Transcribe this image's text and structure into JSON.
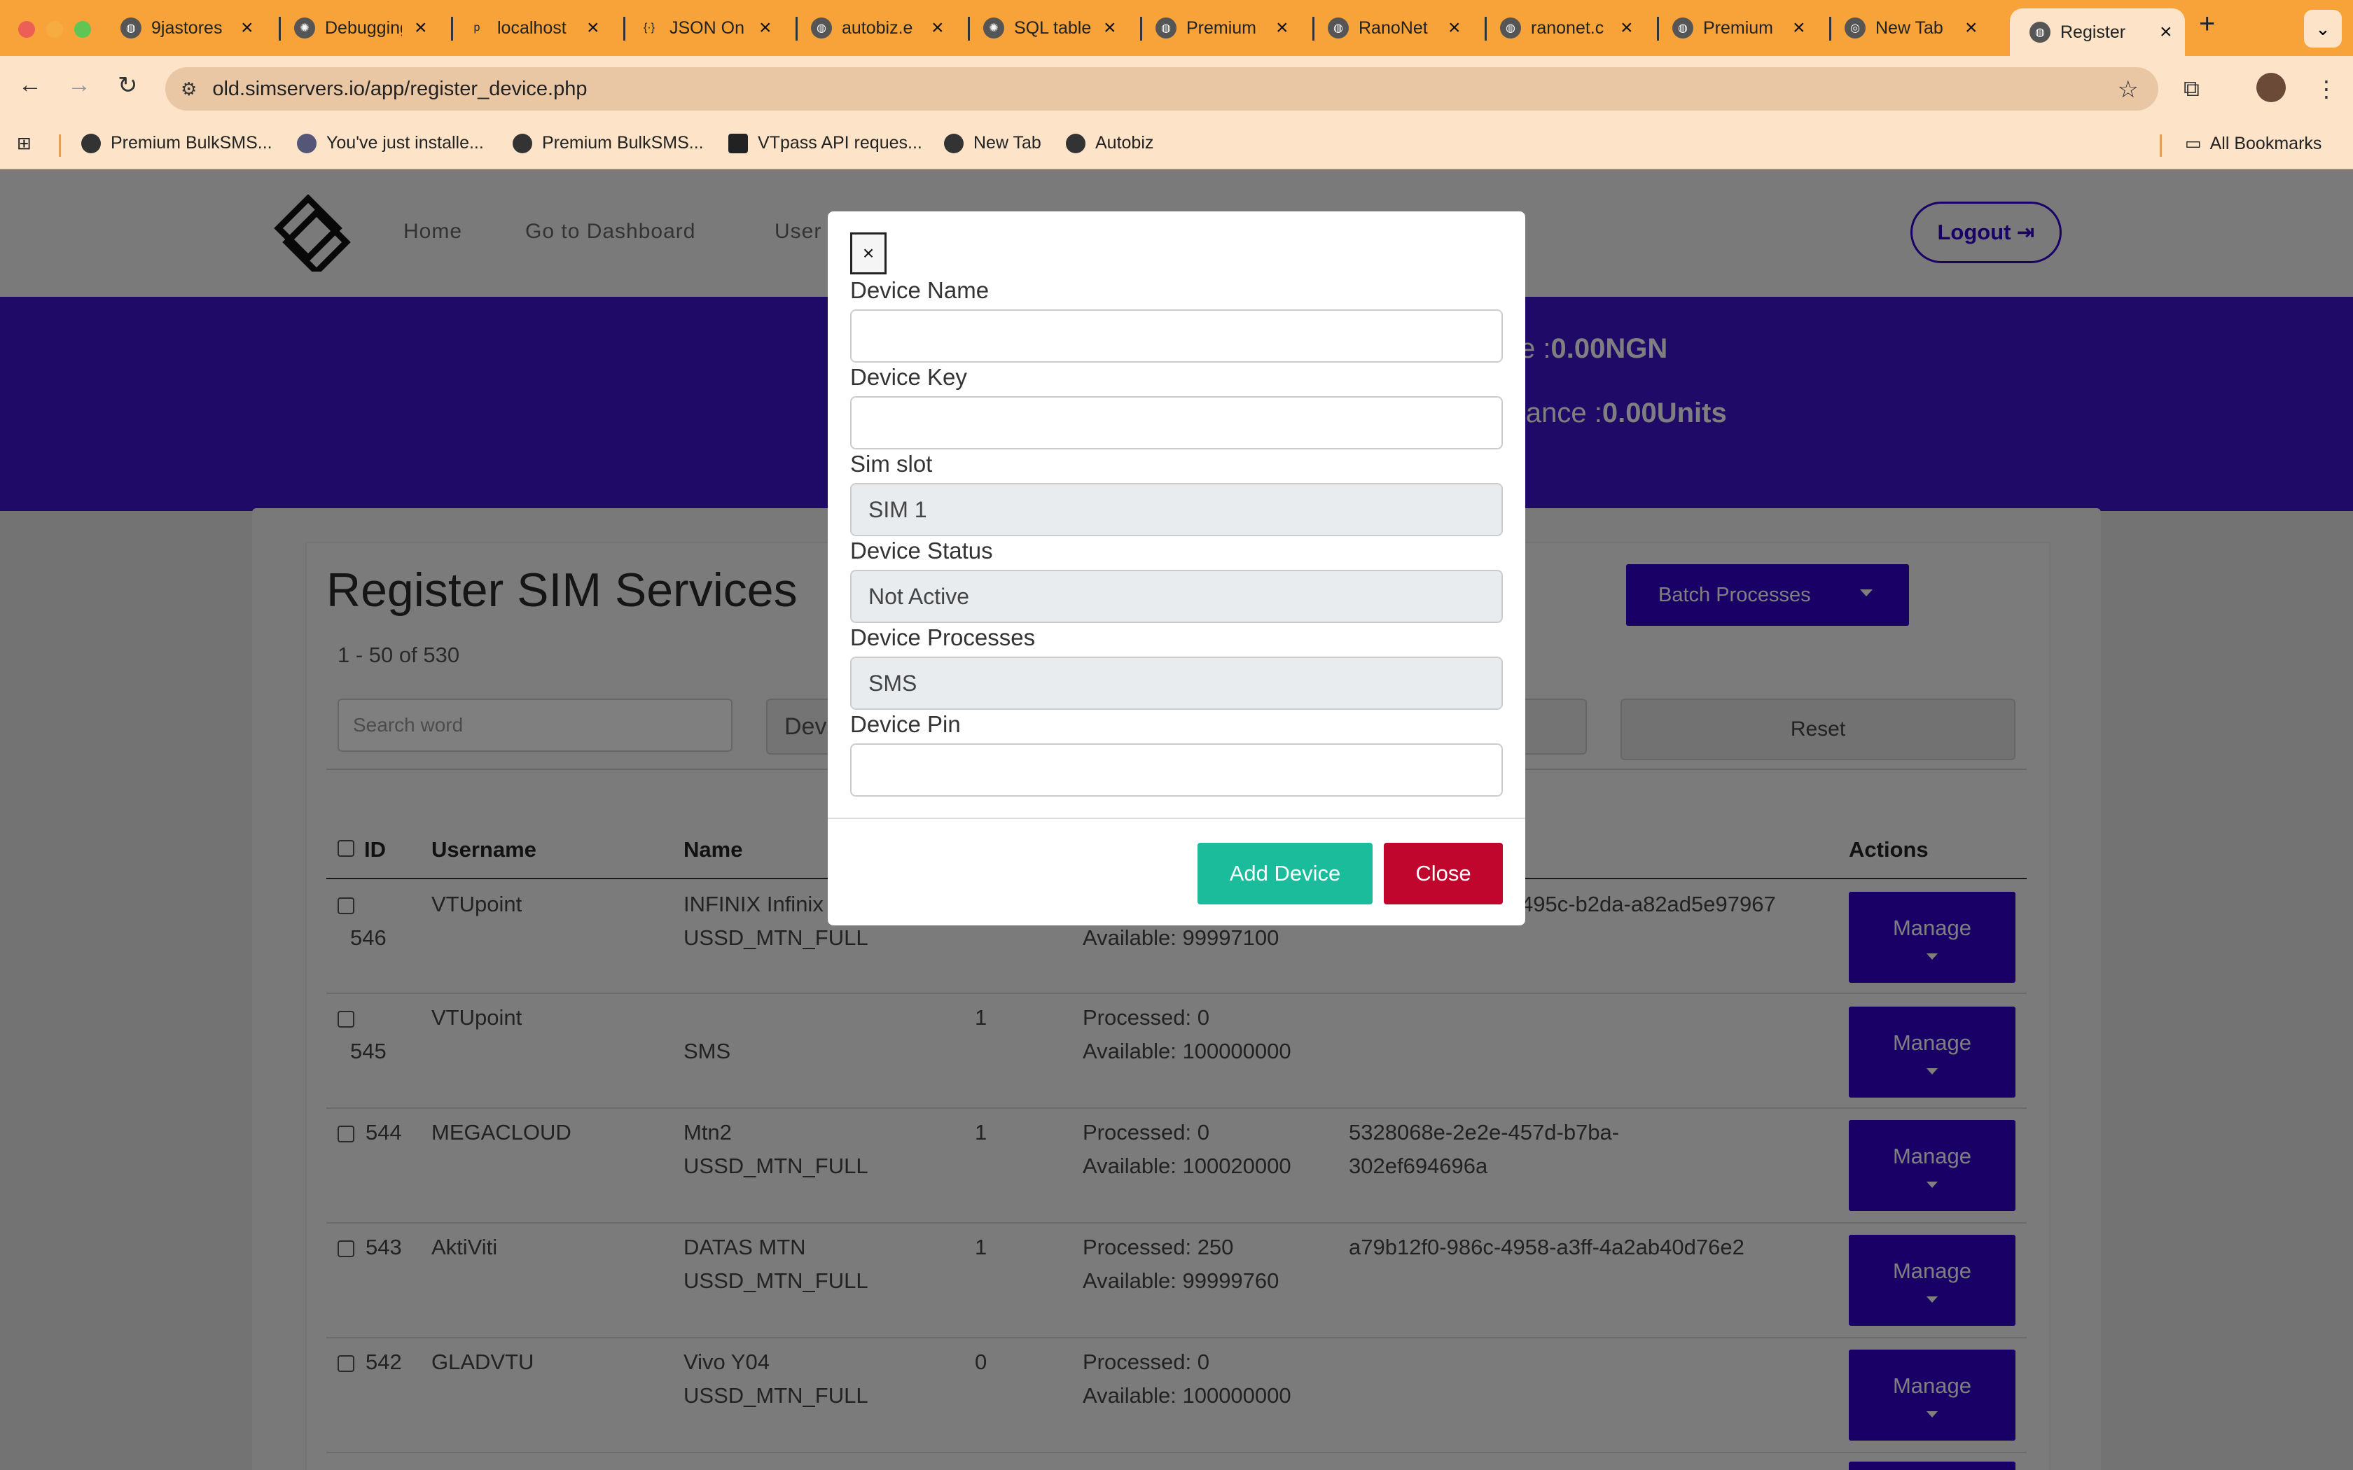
{
  "browser": {
    "tabs": [
      {
        "title": "9jastores",
        "icon": "globe-icon"
      },
      {
        "title": "Debugging",
        "icon": "openai-icon"
      },
      {
        "title": "localhost",
        "icon": "pma-icon"
      },
      {
        "title": "JSON On",
        "icon": "braces-icon"
      },
      {
        "title": "autobiz.e",
        "icon": "globe-icon"
      },
      {
        "title": "SQL table",
        "icon": "openai-icon"
      },
      {
        "title": "Premium",
        "icon": "globe-icon"
      },
      {
        "title": "RanoNet",
        "icon": "globe-icon"
      },
      {
        "title": "ranonet.c",
        "icon": "globe-icon"
      },
      {
        "title": "Premium",
        "icon": "globe-icon"
      },
      {
        "title": "New Tab",
        "icon": "chrome-icon"
      },
      {
        "title": "Register",
        "icon": "globe-icon"
      }
    ],
    "url": "old.simservers.io/app/register_device.php",
    "bookmarks": [
      "Premium BulkSMS...",
      "You've just installe...",
      "Premium BulkSMS...",
      "VTpass API reques...",
      "New Tab",
      "Autobiz"
    ],
    "all_bookmarks": "All Bookmarks"
  },
  "nav": {
    "links": [
      "Home",
      "Go to Dashboard",
      "User"
    ],
    "logout": "Logout"
  },
  "hero": {
    "line1_prefix": "e :",
    "line1_value": "0.00NGN",
    "line2_prefix": "lance :",
    "line2_value": "0.00Units"
  },
  "main": {
    "title": "Register SIM Services",
    "count": "1 - 50 of 530",
    "batch_label": "Batch Processes",
    "search_placeholder": "Search word",
    "device_filter": "Dev",
    "reset_label": "Reset",
    "headers": {
      "id": "ID",
      "username": "Username",
      "name": "Name",
      "actions": "Actions"
    },
    "manage_label": "Manage",
    "rows": [
      {
        "id": "546",
        "username": "VTUpoint",
        "name1": "INFINIX Infinix",
        "name2": "USSD_MTN_FULL",
        "slot": "",
        "proc": "",
        "avail": "Available: 99997100",
        "key1": "495c-b2da-a82ad5e97967",
        "key2": ""
      },
      {
        "id": "545",
        "username": "VTUpoint",
        "name1": "",
        "name2": "SMS",
        "slot": "1",
        "proc": "Processed: 0",
        "avail": "Available: 100000000",
        "key1": "",
        "key2": ""
      },
      {
        "id": "544",
        "username": "MEGACLOUD",
        "name1": "Mtn2",
        "name2": "USSD_MTN_FULL",
        "slot": "1",
        "proc": "Processed: 0",
        "avail": "Available: 100020000",
        "key1": "5328068e-2e2e-457d-b7ba-",
        "key2": "302ef694696a"
      },
      {
        "id": "543",
        "username": "AktiViti",
        "name1": "DATAS MTN",
        "name2": "USSD_MTN_FULL",
        "slot": "1",
        "proc": "Processed: 250",
        "avail": "Available: 99999760",
        "key1": "a79b12f0-986c-4958-a3ff-4a2ab40d76e2",
        "key2": ""
      },
      {
        "id": "542",
        "username": "GLADVTU",
        "name1": "Vivo Y04",
        "name2": "USSD_MTN_FULL",
        "slot": "0",
        "proc": "Processed: 0",
        "avail": "Available: 100000000",
        "key1": "",
        "key2": ""
      }
    ]
  },
  "modal": {
    "close_x": "×",
    "fields": [
      {
        "label": "Device Name",
        "value": ""
      },
      {
        "label": "Device Key",
        "value": ""
      },
      {
        "label": "Sim slot",
        "value": "SIM 1"
      },
      {
        "label": "Device Status",
        "value": "Not Active"
      },
      {
        "label": "Device Processes",
        "value": "SMS"
      },
      {
        "label": "Device Pin",
        "value": ""
      }
    ],
    "add_label": "Add Device",
    "close_label": "Close"
  },
  "colors": {
    "accent": "#3300cc",
    "browser": "#f7a33a",
    "add": "#1abc9c",
    "close": "#c0062c"
  }
}
